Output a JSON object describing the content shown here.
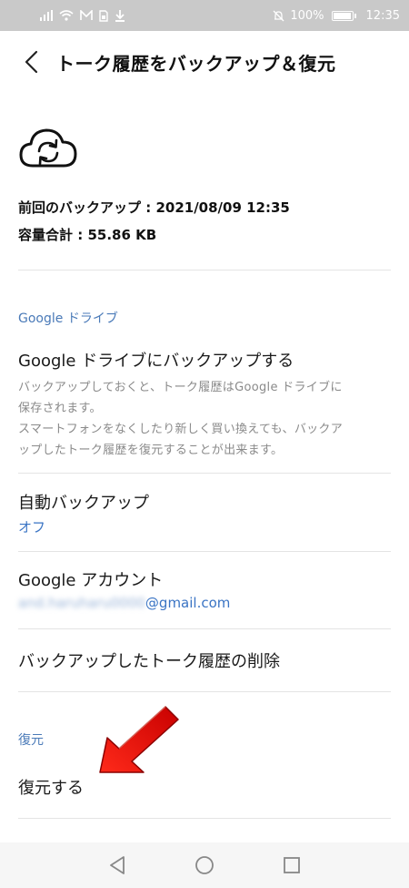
{
  "status_bar": {
    "battery": "100%",
    "time": "12:35"
  },
  "header": {
    "title": "トーク履歴をバックアップ＆復元"
  },
  "backup_info": {
    "last_backup": "前回のバックアップ : 2021/08/09 12:35",
    "total_size": "容量合計 : 55.86 KB"
  },
  "google_section": {
    "header": "Google ドライブ",
    "backup_item": {
      "title": "Google ドライブにバックアップする",
      "desc_line1": "バックアップしておくと、トーク履歴はGoogle ドライブに",
      "desc_line2": "保存されます。",
      "desc_line3": "スマートフォンをなくしたり新しく買い換えても、バックア",
      "desc_line4": "ップしたトーク履歴を復元することが出来ます。"
    },
    "auto_backup": {
      "title": "自動バックアップ",
      "value": "オフ"
    },
    "account": {
      "title": "Google アカウント",
      "email_hidden": "and.haruharu0000",
      "email_domain": "@gmail.com"
    },
    "delete_item": {
      "title": "バックアップしたトーク履歴の削除"
    }
  },
  "restore_section": {
    "header": "復元",
    "restore_item": {
      "title": "復元する"
    }
  },
  "colors": {
    "accent": "#4a7ab8",
    "annotation_arrow": "#e01010"
  }
}
